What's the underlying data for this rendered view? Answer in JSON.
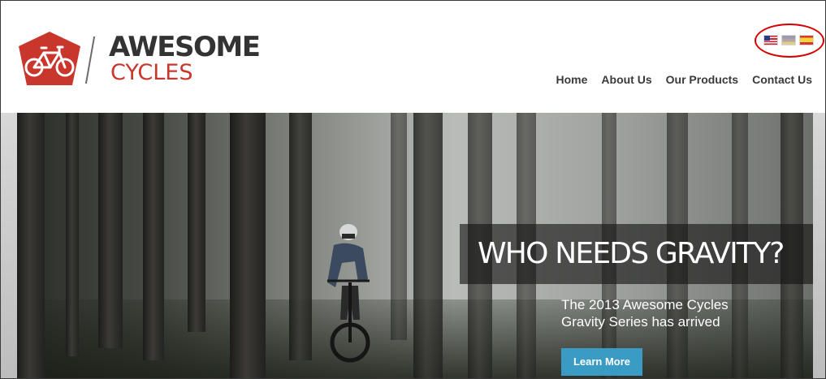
{
  "brand": {
    "word1": "AWESOME",
    "word2": "CYCLES",
    "accent_color": "#c9372c",
    "text_color": "#333333"
  },
  "languages": [
    {
      "code": "en-US",
      "icon": "us-flag-icon"
    },
    {
      "code": "de",
      "icon": "german-flag-icon"
    },
    {
      "code": "es",
      "icon": "spanish-flag-icon"
    }
  ],
  "nav": {
    "items": [
      {
        "label": "Home"
      },
      {
        "label": "About Us"
      },
      {
        "label": "Our Products"
      },
      {
        "label": "Contact Us"
      }
    ]
  },
  "hero": {
    "headline": "WHO NEEDS GRAVITY?",
    "subtext": "The 2013 Awesome Cycles Gravity Series has arrived",
    "cta_label": "Learn More",
    "cta_color": "#3a9bc4"
  }
}
